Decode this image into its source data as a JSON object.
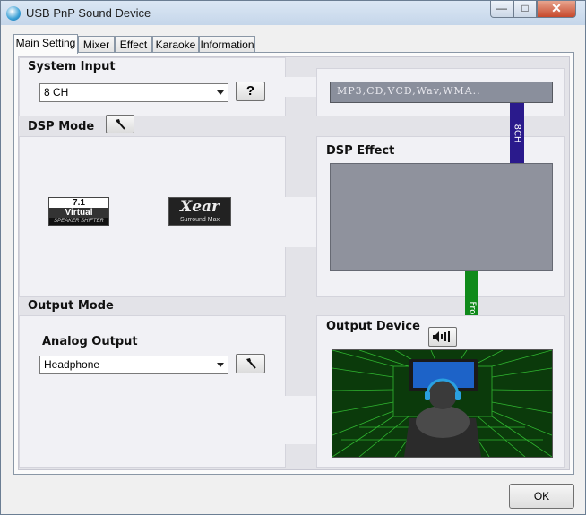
{
  "window": {
    "title": "USB PnP Sound Device"
  },
  "tabs": [
    {
      "label": "Main Setting"
    },
    {
      "label": "Mixer"
    },
    {
      "label": "Effect"
    },
    {
      "label": "Karaoke"
    },
    {
      "label": "Information"
    }
  ],
  "system_input": {
    "heading": "System Input",
    "selected": "8 CH",
    "help_label": "?",
    "source_display": "MP3,CD,VCD,Wav,WMA.."
  },
  "dsp_mode": {
    "heading": "DSP Mode",
    "logo_71_top": "7.1",
    "logo_71_mid": "Virtual",
    "logo_71_bottom": "SPEAKER SHIFTER",
    "logo_xear_top": "Xear",
    "logo_xear_bottom": "Surround Max"
  },
  "dsp_effect": {
    "heading": "DSP Effect"
  },
  "signal": {
    "top_bar": "8CH",
    "bottom_bar": "Front"
  },
  "output_mode": {
    "heading": "Output Mode",
    "sub_heading": "Analog Output",
    "selected": "Headphone"
  },
  "output_device": {
    "heading": "Output Device"
  },
  "colors": {
    "bar_8ch": "#2a1a8c",
    "bar_front": "#0f8a1a",
    "lcd": "#8a8f9c",
    "scene_grid": "#3ad63a"
  },
  "footer": {
    "ok_label": "OK"
  }
}
